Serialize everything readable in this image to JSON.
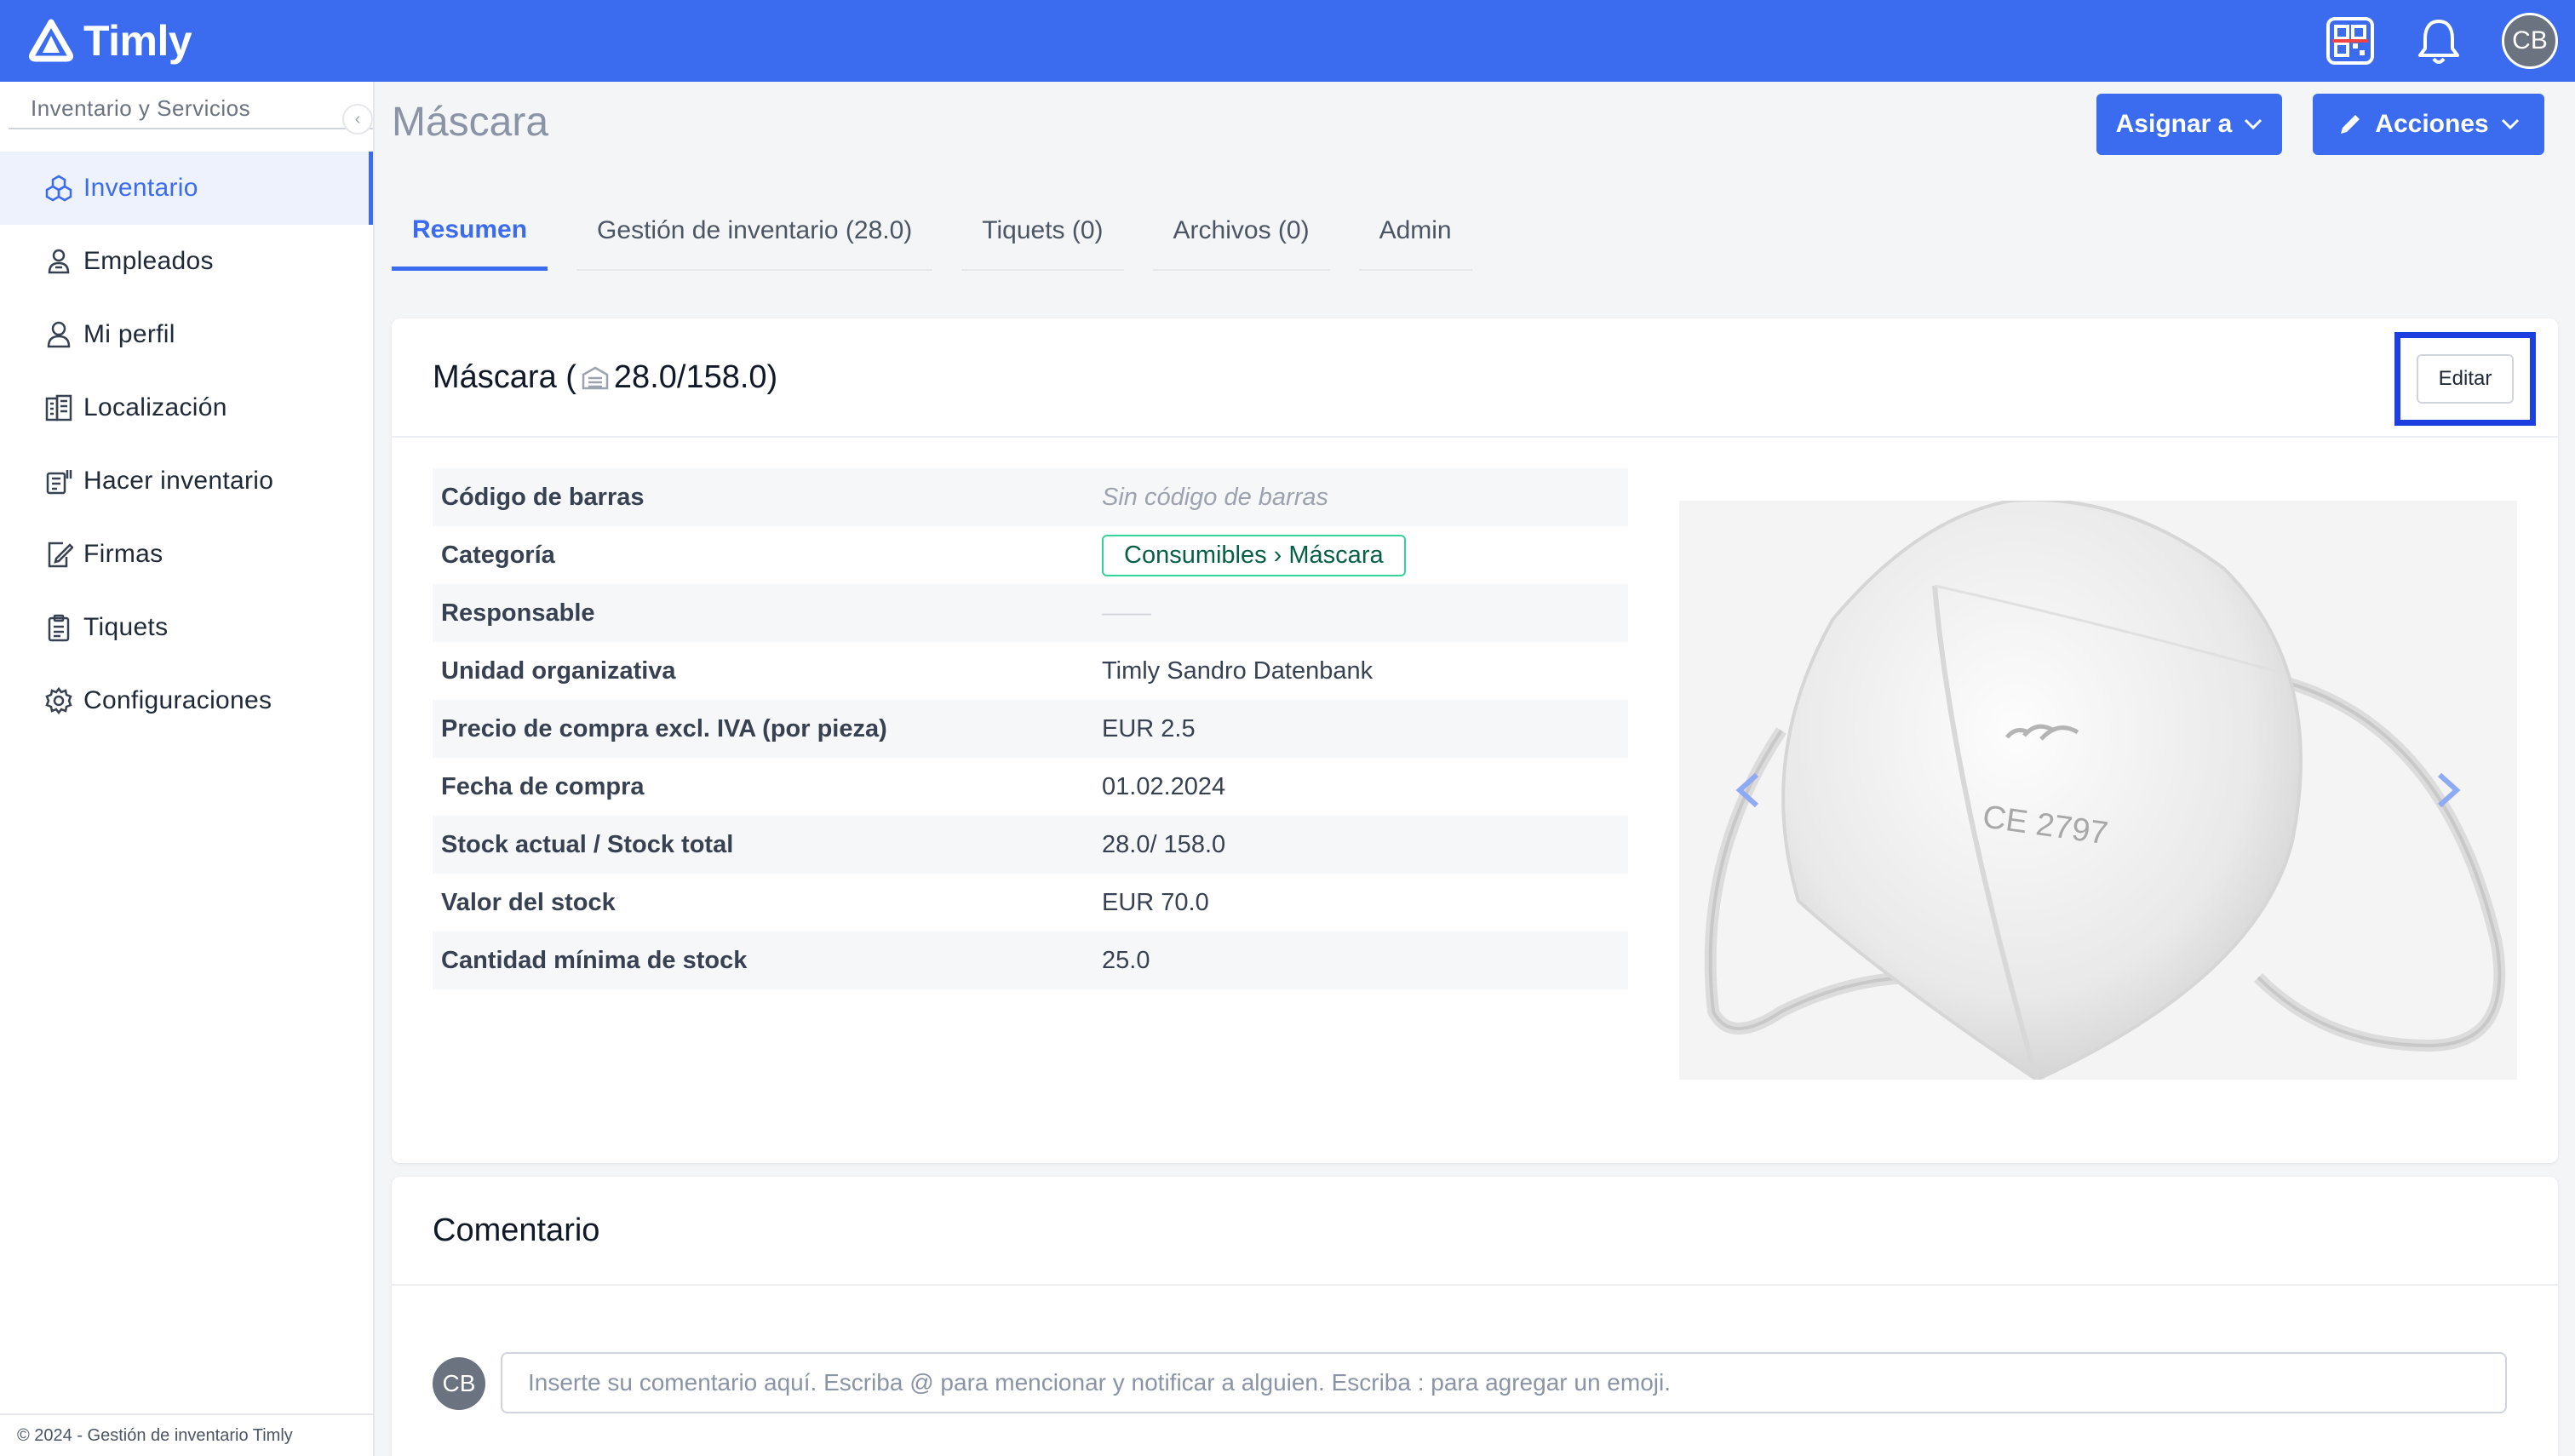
{
  "app": {
    "name": "Timly",
    "user_initials": "CB"
  },
  "sidebar": {
    "section_title": "Inventario y Servicios",
    "items": [
      {
        "label": "Inventario",
        "icon": "cubes-icon",
        "active": true
      },
      {
        "label": "Empleados",
        "icon": "employees-icon"
      },
      {
        "label": "Mi perfil",
        "icon": "user-icon"
      },
      {
        "label": "Localización",
        "icon": "building-icon"
      },
      {
        "label": "Hacer inventario",
        "icon": "scan-icon"
      },
      {
        "label": "Firmas",
        "icon": "signature-icon"
      },
      {
        "label": "Tiquets",
        "icon": "clipboard-icon"
      },
      {
        "label": "Configuraciones",
        "icon": "gear-icon"
      }
    ],
    "footer": "© 2024 - Gestión de inventario Timly"
  },
  "page": {
    "title": "Máscara",
    "assign_label": "Asignar a",
    "actions_label": "Acciones"
  },
  "tabs": [
    {
      "label": "Resumen",
      "active": true
    },
    {
      "label": "Gestión de inventario (28.0)"
    },
    {
      "label": "Tiquets (0)"
    },
    {
      "label": "Archivos (0)"
    },
    {
      "label": "Admin"
    }
  ],
  "item": {
    "name": "Máscara (",
    "stock": "28.0/158.0)",
    "edit_label": "Editar",
    "details": [
      {
        "label": "Código de barras",
        "value": "Sin código de barras",
        "style": "muted"
      },
      {
        "label": "Categoría",
        "value": "Consumibles › Máscara",
        "style": "badge"
      },
      {
        "label": "Responsable",
        "value": "——",
        "style": "empty"
      },
      {
        "label": "Unidad organizativa",
        "value": "Timly Sandro Datenbank"
      },
      {
        "label": "Precio de compra excl. IVA (por pieza)",
        "value": "EUR 2.5"
      },
      {
        "label": "Fecha de compra",
        "value": "01.02.2024"
      },
      {
        "label": "Stock actual  / Stock total",
        "value": "28.0/ 158.0"
      },
      {
        "label": "Valor del stock",
        "value": "EUR 70.0"
      },
      {
        "label": "Cantidad mínima de stock",
        "value": "25.0"
      }
    ],
    "image_text": "CE 2797"
  },
  "comments": {
    "title": "Comentario",
    "placeholder": "Inserte su comentario aquí. Escriba @ para mencionar y notificar a alguien. Escriba : para agregar un emoji.",
    "user_initials": "CB"
  },
  "colors": {
    "brand": "#3b6cf0",
    "highlight": "#1d3fe0",
    "badge_border": "#34d399"
  }
}
